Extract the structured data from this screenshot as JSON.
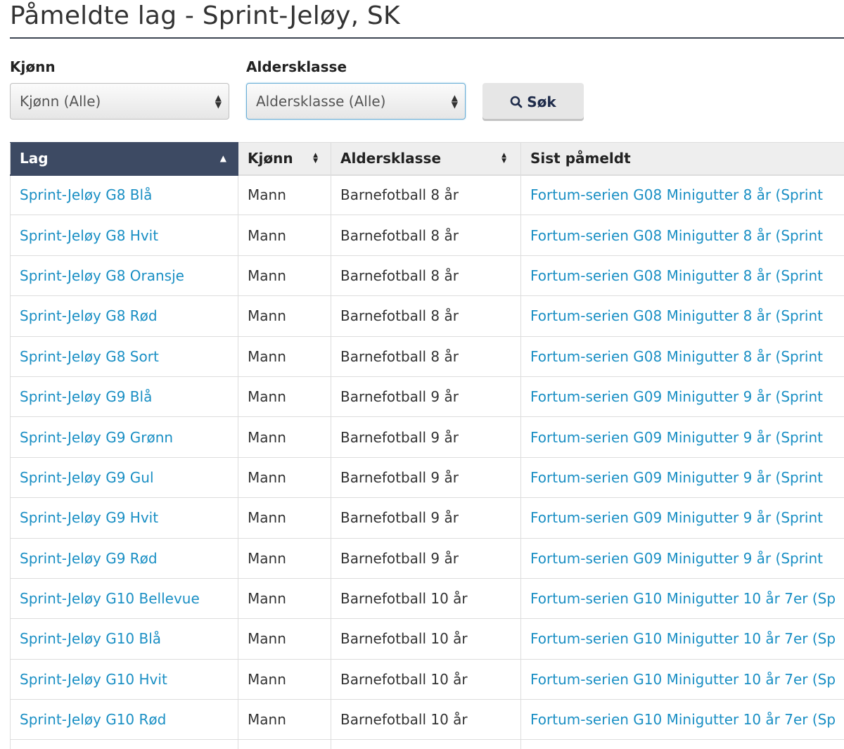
{
  "page": {
    "title": "Påmeldte lag - Sprint-Jeløy, SK"
  },
  "filters": {
    "gender": {
      "label": "Kjønn",
      "selected": "Kjønn (Alle)"
    },
    "age_class": {
      "label": "Aldersklasse",
      "selected": "Aldersklasse (Alle)"
    },
    "search_button": {
      "label": "Søk",
      "icon": "search-icon"
    }
  },
  "table": {
    "columns": [
      {
        "label": "Lag",
        "sort": "ascending"
      },
      {
        "label": "Kjønn",
        "sort": "sortable"
      },
      {
        "label": "Aldersklasse",
        "sort": "sortable"
      },
      {
        "label": "Sist påmeldt",
        "sort": "none"
      }
    ],
    "rows": [
      {
        "team": "Sprint-Jeløy G8 Blå",
        "gender": "Mann",
        "age_class": "Barnefotball 8 år",
        "last_registered": "Fortum-serien G08 Minigutter 8 år (Sprint"
      },
      {
        "team": "Sprint-Jeløy G8 Hvit",
        "gender": "Mann",
        "age_class": "Barnefotball 8 år",
        "last_registered": "Fortum-serien G08 Minigutter 8 år (Sprint"
      },
      {
        "team": "Sprint-Jeløy G8 Oransje",
        "gender": "Mann",
        "age_class": "Barnefotball 8 år",
        "last_registered": "Fortum-serien G08 Minigutter 8 år (Sprint"
      },
      {
        "team": "Sprint-Jeløy G8 Rød",
        "gender": "Mann",
        "age_class": "Barnefotball 8 år",
        "last_registered": "Fortum-serien G08 Minigutter 8 år (Sprint"
      },
      {
        "team": "Sprint-Jeløy G8 Sort",
        "gender": "Mann",
        "age_class": "Barnefotball 8 år",
        "last_registered": "Fortum-serien G08 Minigutter 8 år (Sprint"
      },
      {
        "team": "Sprint-Jeløy G9 Blå",
        "gender": "Mann",
        "age_class": "Barnefotball 9 år",
        "last_registered": "Fortum-serien G09 Minigutter 9 år (Sprint"
      },
      {
        "team": "Sprint-Jeløy G9 Grønn",
        "gender": "Mann",
        "age_class": "Barnefotball 9 år",
        "last_registered": "Fortum-serien G09 Minigutter 9 år (Sprint"
      },
      {
        "team": "Sprint-Jeløy G9 Gul",
        "gender": "Mann",
        "age_class": "Barnefotball 9 år",
        "last_registered": "Fortum-serien G09 Minigutter 9 år (Sprint"
      },
      {
        "team": "Sprint-Jeløy G9 Hvit",
        "gender": "Mann",
        "age_class": "Barnefotball 9 år",
        "last_registered": "Fortum-serien G09 Minigutter 9 år (Sprint"
      },
      {
        "team": "Sprint-Jeløy G9 Rød",
        "gender": "Mann",
        "age_class": "Barnefotball 9 år",
        "last_registered": "Fortum-serien G09 Minigutter 9 år (Sprint"
      },
      {
        "team": "Sprint-Jeløy G10 Bellevue",
        "gender": "Mann",
        "age_class": "Barnefotball 10 år",
        "last_registered": "Fortum-serien G10 Minigutter 10 år 7er (Sp"
      },
      {
        "team": "Sprint-Jeløy G10 Blå",
        "gender": "Mann",
        "age_class": "Barnefotball 10 år",
        "last_registered": "Fortum-serien G10 Minigutter 10 år 7er (Sp"
      },
      {
        "team": "Sprint-Jeløy G10 Hvit",
        "gender": "Mann",
        "age_class": "Barnefotball 10 år",
        "last_registered": "Fortum-serien G10 Minigutter 10 år 7er (Sp"
      },
      {
        "team": "Sprint-Jeløy G10 Rød",
        "gender": "Mann",
        "age_class": "Barnefotball 10 år",
        "last_registered": "Fortum-serien G10 Minigutter 10 år 7er (Sp"
      },
      {
        "team": "",
        "gender": "",
        "age_class": "",
        "last_registered": ""
      }
    ]
  },
  "colors": {
    "link": "#1a8fc4",
    "header_active_bg": "#3d4a63",
    "header_bg": "#eeeeee",
    "title_rule": "#3d4552"
  }
}
